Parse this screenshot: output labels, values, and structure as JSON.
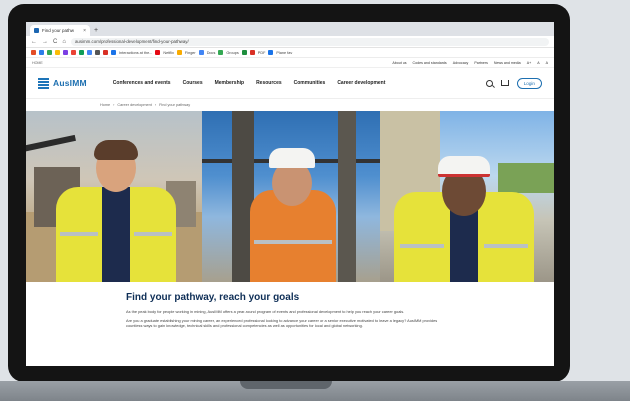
{
  "browser": {
    "tab_title": "Find your pathw",
    "tab_close": "×",
    "new_tab": "+",
    "nav": {
      "back": "←",
      "forward": "→",
      "reload": "C",
      "home": "⌂"
    },
    "url": "ausimm.com/professional-development/find-your-pathway/",
    "bookmarks": [
      {
        "label": "",
        "color": "#e34c26"
      },
      {
        "label": "",
        "color": "#2b7de9"
      },
      {
        "label": "",
        "color": "#34a853"
      },
      {
        "label": "",
        "color": "#fbbc05"
      },
      {
        "label": "",
        "color": "#7b3fe4"
      },
      {
        "label": "",
        "color": "#ea4335"
      },
      {
        "label": "",
        "color": "#0f9d58"
      },
      {
        "label": "",
        "color": "#4285f4"
      },
      {
        "label": "",
        "color": "#555555"
      },
      {
        "label": "",
        "color": "#d93025"
      },
      {
        "label": "Interactions at the...",
        "color": "#1a73e8"
      },
      {
        "label": "Netflix",
        "color": "#e50914"
      },
      {
        "label": "Finger",
        "color": "#f9ab00"
      },
      {
        "label": "Docs",
        "color": "#4285f4"
      },
      {
        "label": "Groups",
        "color": "#34a853"
      },
      {
        "label": "",
        "color": "#1e8e3e"
      },
      {
        "label": "PDF",
        "color": "#d93025"
      },
      {
        "label": "Plane fav",
        "color": "#1a73e8"
      }
    ]
  },
  "utility_bar": {
    "left": "HOME",
    "links": [
      "About us",
      "Codes and standards",
      "Advocacy",
      "Partners",
      "News and media",
      "A+",
      "A",
      "A"
    ]
  },
  "site_nav": {
    "logo_text": "AusIMM",
    "menu": [
      "Conferences and events",
      "Courses",
      "Membership",
      "Resources",
      "Communities",
      "Career development"
    ],
    "login": "Login"
  },
  "breadcrumb": [
    "Home",
    "›",
    "Career development",
    "›",
    "Find your pathway"
  ],
  "content": {
    "heading": "Find your pathway, reach your goals",
    "para1": "As the peak body for people working in mining, AusIMM offers a year-round program of events and professional development to help you reach your career goals.",
    "para2": "Are you a graduate establishing your mining career, an experienced professional looking to advance your career or a senior executive motivated to leave a legacy? AusIMM provides countless ways to gain knowledge, technical skills and professional competencies as well as opportunities for local and global networking."
  },
  "colors": {
    "accent": "#1d6fb0",
    "heading": "#0f2f57",
    "hi_vis_yellow": "#e6e23a",
    "hi_vis_orange": "#e7802f",
    "navy": "#1d2b4d"
  }
}
